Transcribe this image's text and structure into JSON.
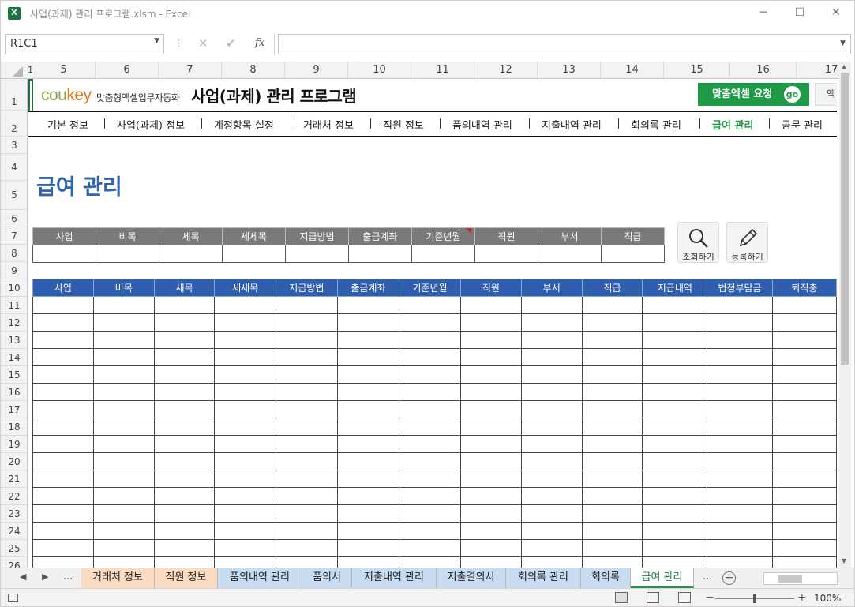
{
  "window": {
    "app_icon": "X",
    "title": "사업(과제) 관리 프로그램.xlsm - Excel",
    "minimize": "─",
    "maximize": "☐",
    "close": "✕"
  },
  "formula_bar": {
    "name_box": "R1C1",
    "name_box_arrow": "▼",
    "separator": "⋮",
    "cancel": "✕",
    "confirm": "✔",
    "fx": "fx",
    "formula": "",
    "expand_arrow": "▼"
  },
  "columns": [
    "1",
    "5",
    "6",
    "7",
    "8",
    "9",
    "10",
    "11",
    "12",
    "13",
    "14",
    "15",
    "16",
    "17"
  ],
  "rows": [
    "1",
    "2",
    "3",
    "4",
    "5",
    "6",
    "7",
    "8",
    "9",
    "10",
    "11",
    "12",
    "13",
    "14",
    "15",
    "16",
    "17",
    "18",
    "19",
    "20",
    "21",
    "22",
    "23",
    "24",
    "25",
    "26"
  ],
  "sheet": {
    "logo_main": "cou",
    "logo_accent": "key",
    "logo_sub": "맞춤형엑셀업무자동화",
    "title": "사업(과제) 관리 프로그램",
    "request_button": "맞춤엑셀 요청",
    "request_go": "go",
    "request_button2": "엑",
    "nav": [
      {
        "label": "기본 정보",
        "active": false
      },
      {
        "label": "사업(과제) 정보",
        "active": false
      },
      {
        "label": "계정항목 설정",
        "active": false
      },
      {
        "label": "거래처 정보",
        "active": false
      },
      {
        "label": "직원 정보",
        "active": false
      },
      {
        "label": "품의내역 관리",
        "active": false
      },
      {
        "label": "지출내역 관리",
        "active": false
      },
      {
        "label": "회의록 관리",
        "active": false
      },
      {
        "label": "급여 관리",
        "active": true
      },
      {
        "label": "공문 관리",
        "active": false
      }
    ],
    "page_title": "급여 관리",
    "filter_headers": [
      "사업",
      "비목",
      "세목",
      "세세목",
      "지급방법",
      "출금계좌",
      "기준년월",
      "직원",
      "부서",
      "직급"
    ],
    "search_button": "조회하기",
    "register_button": "등록하기",
    "data_headers": [
      "사업",
      "비목",
      "세목",
      "세세목",
      "지급방법",
      "출금계좌",
      "기준년월",
      "직원",
      "부서",
      "직급",
      "지급내역",
      "법정부담금",
      "퇴직충"
    ]
  },
  "tabs": {
    "prev": "◀",
    "next": "▶",
    "more_left": "...",
    "more_right": "...",
    "items": [
      {
        "label": "거래처 정보",
        "style": "orange"
      },
      {
        "label": "직원 정보",
        "style": "orange"
      },
      {
        "label": "품의내역 관리",
        "style": "blue"
      },
      {
        "label": "품의서",
        "style": "blue"
      },
      {
        "label": "지출내역 관리",
        "style": "blue"
      },
      {
        "label": "지출결의서",
        "style": "blue"
      },
      {
        "label": "회의록 관리",
        "style": "blue"
      },
      {
        "label": "회의록",
        "style": "blue"
      },
      {
        "label": "급여 관리",
        "style": "active"
      }
    ],
    "add": "+"
  },
  "status": {
    "zoom": "100%",
    "zoom_minus": "−",
    "zoom_plus": "+"
  }
}
